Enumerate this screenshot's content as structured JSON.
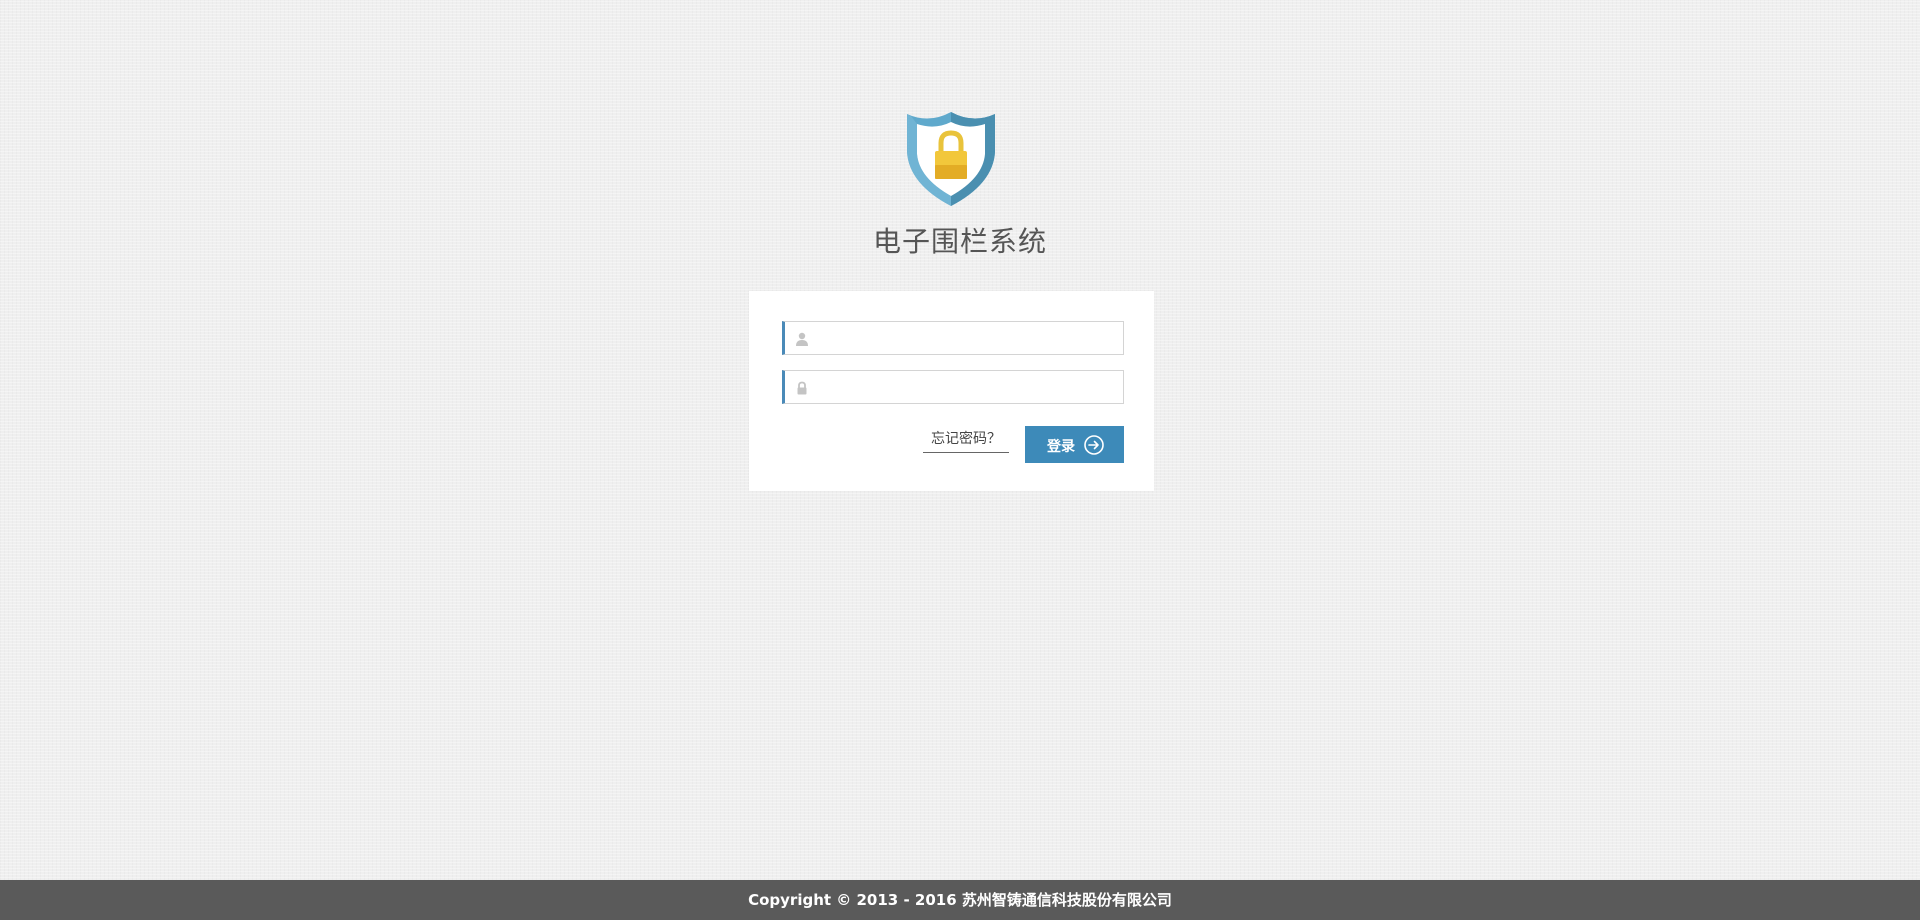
{
  "header": {
    "logo_icon": "shield-lock-icon",
    "title": "电子围栏系统"
  },
  "login_form": {
    "username": {
      "icon": "user-icon",
      "value": "",
      "placeholder": ""
    },
    "password": {
      "icon": "lock-icon",
      "value": "",
      "placeholder": ""
    },
    "forgot_password_label": "忘记密码？",
    "login_button_label": "登录",
    "login_button_icon": "arrow-right-circle-icon"
  },
  "footer": {
    "copyright": "Copyright © 2013 - 2016 苏州智铸通信科技股份有限公司"
  },
  "colors": {
    "accent": "#3d8ab9",
    "background": "#efefef",
    "footer_bg": "#5a5a5a",
    "title_text": "#555555"
  }
}
